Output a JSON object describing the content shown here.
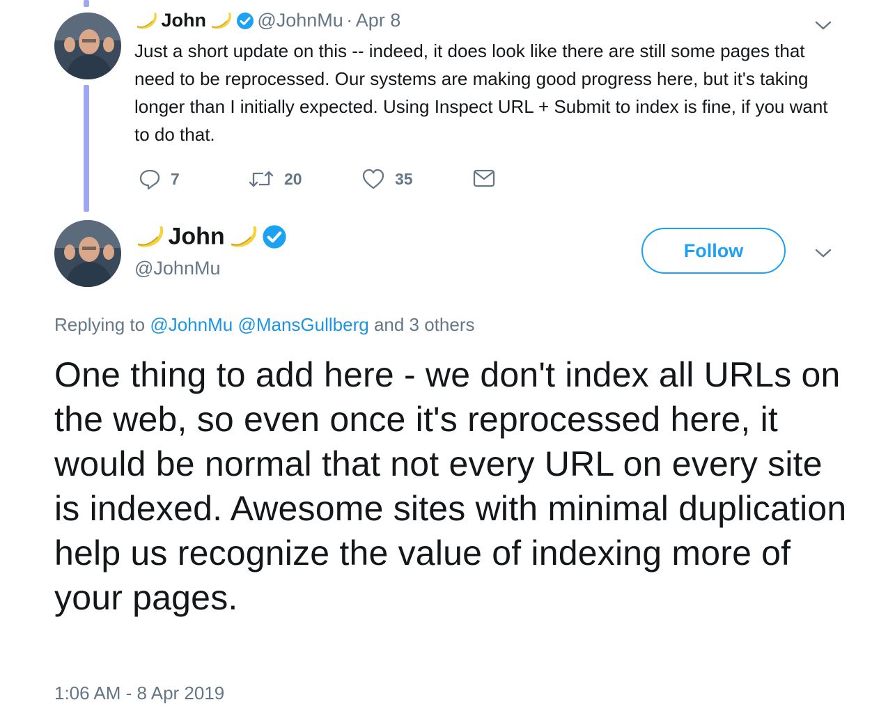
{
  "thread": {
    "name": "John",
    "handle": "@JohnMu",
    "dot": "·",
    "date": "Apr 8",
    "text": "Just a short update on this -- indeed, it does look like there are still some pages that need to be reprocessed. Our systems are making good progress here, but it's taking longer than I initially expected. Using Inspect URL + Submit to index is fine, if you want to do that.",
    "reply_count": "7",
    "retweet_count": "20",
    "like_count": "35"
  },
  "main": {
    "name": "John",
    "handle": "@JohnMu",
    "follow_label": "Follow",
    "replying_prefix": "Replying to",
    "reply_to_1": "@JohnMu",
    "reply_to_2": "@MansGullberg",
    "reply_suffix": "and 3 others",
    "text": "One thing to add here - we don't index all URLs on the web, so even once it's reprocessed here, it would be normal that not every URL on every site is indexed. Awesome sites with minimal duplication help us recognize the value of indexing more of your pages.",
    "timestamp": "1:06 AM - 8 Apr 2019"
  },
  "colors": {
    "accent": "#1da1f2",
    "link": "#1b95e0",
    "muted": "#657786",
    "thread_line": "#9fa7f2"
  },
  "icons": [
    "banana-emoji",
    "verified-badge-icon",
    "chevron-down-icon",
    "reply-icon",
    "retweet-icon",
    "like-icon",
    "message-icon",
    "avatar"
  ]
}
